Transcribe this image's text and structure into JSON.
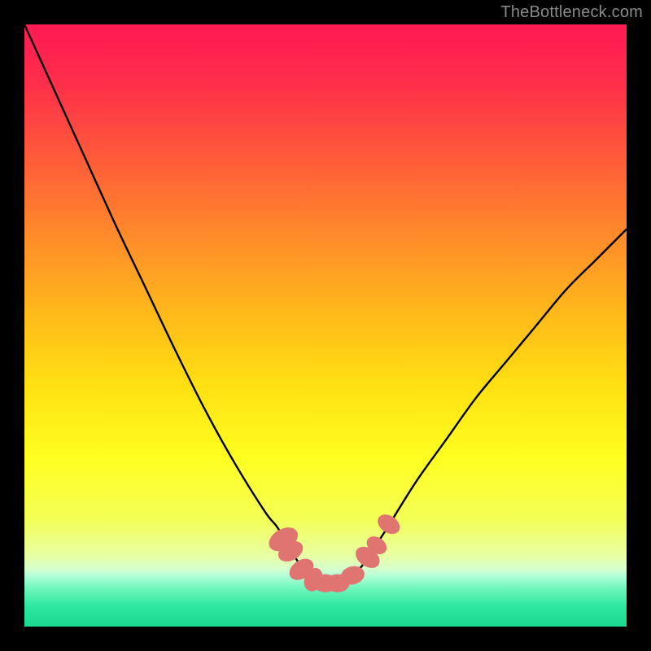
{
  "watermark": "TheBottleneck.com",
  "chart_data": {
    "type": "line",
    "title": "",
    "xlabel": "",
    "ylabel": "",
    "xlim": [
      0,
      100
    ],
    "ylim": [
      0,
      100
    ],
    "series": [
      {
        "name": "curve",
        "x": [
          0,
          5,
          10,
          15,
          20,
          25,
          30,
          35,
          40,
          42,
          44,
          46,
          48,
          50,
          52,
          54,
          56,
          58,
          60,
          65,
          70,
          75,
          80,
          85,
          90,
          95,
          100
        ],
        "y": [
          100,
          89,
          78,
          67,
          56.5,
          46,
          36,
          27,
          19,
          16.5,
          13,
          10,
          8,
          7,
          7,
          8,
          10,
          13,
          16,
          24,
          31,
          38,
          44,
          50,
          56,
          61,
          66
        ]
      }
    ],
    "markers": [
      {
        "x": 43.0,
        "y": 14.5,
        "rx": 1.7,
        "ry": 2.6,
        "angle": 60
      },
      {
        "x": 44.2,
        "y": 12.5,
        "rx": 1.5,
        "ry": 2.2,
        "angle": 60
      },
      {
        "x": 46.0,
        "y": 9.5,
        "rx": 1.5,
        "ry": 2.2,
        "angle": 55
      },
      {
        "x": 48.0,
        "y": 7.8,
        "rx": 1.5,
        "ry": 2.0,
        "angle": 20
      },
      {
        "x": 50.0,
        "y": 7.2,
        "rx": 2.0,
        "ry": 1.5,
        "angle": 0
      },
      {
        "x": 52.0,
        "y": 7.2,
        "rx": 2.0,
        "ry": 1.5,
        "angle": 0
      },
      {
        "x": 54.5,
        "y": 8.5,
        "rx": 2.0,
        "ry": 1.5,
        "angle": -15
      },
      {
        "x": 57.0,
        "y": 11.5,
        "rx": 1.5,
        "ry": 2.2,
        "angle": -55
      },
      {
        "x": 58.5,
        "y": 13.5,
        "rx": 1.3,
        "ry": 1.8,
        "angle": -55
      },
      {
        "x": 60.5,
        "y": 17.0,
        "rx": 1.4,
        "ry": 2.0,
        "angle": -55
      }
    ],
    "gradient_stops": [
      {
        "offset": 0.0,
        "color": "#ff1a54"
      },
      {
        "offset": 0.1,
        "color": "#ff2f4a"
      },
      {
        "offset": 0.22,
        "color": "#ff5a3a"
      },
      {
        "offset": 0.35,
        "color": "#ff8a2a"
      },
      {
        "offset": 0.48,
        "color": "#ffb91a"
      },
      {
        "offset": 0.6,
        "color": "#ffe012"
      },
      {
        "offset": 0.72,
        "color": "#ffff20"
      },
      {
        "offset": 0.82,
        "color": "#f4ff55"
      },
      {
        "offset": 0.885,
        "color": "#e8ffa8"
      },
      {
        "offset": 0.905,
        "color": "#d4ffcf"
      },
      {
        "offset": 0.915,
        "color": "#b4ffd9"
      },
      {
        "offset": 0.935,
        "color": "#73f7bd"
      },
      {
        "offset": 0.965,
        "color": "#2fe8a0"
      },
      {
        "offset": 1.0,
        "color": "#18d98e"
      }
    ],
    "marker_color": "#df7470",
    "curve_color": "#000000"
  }
}
